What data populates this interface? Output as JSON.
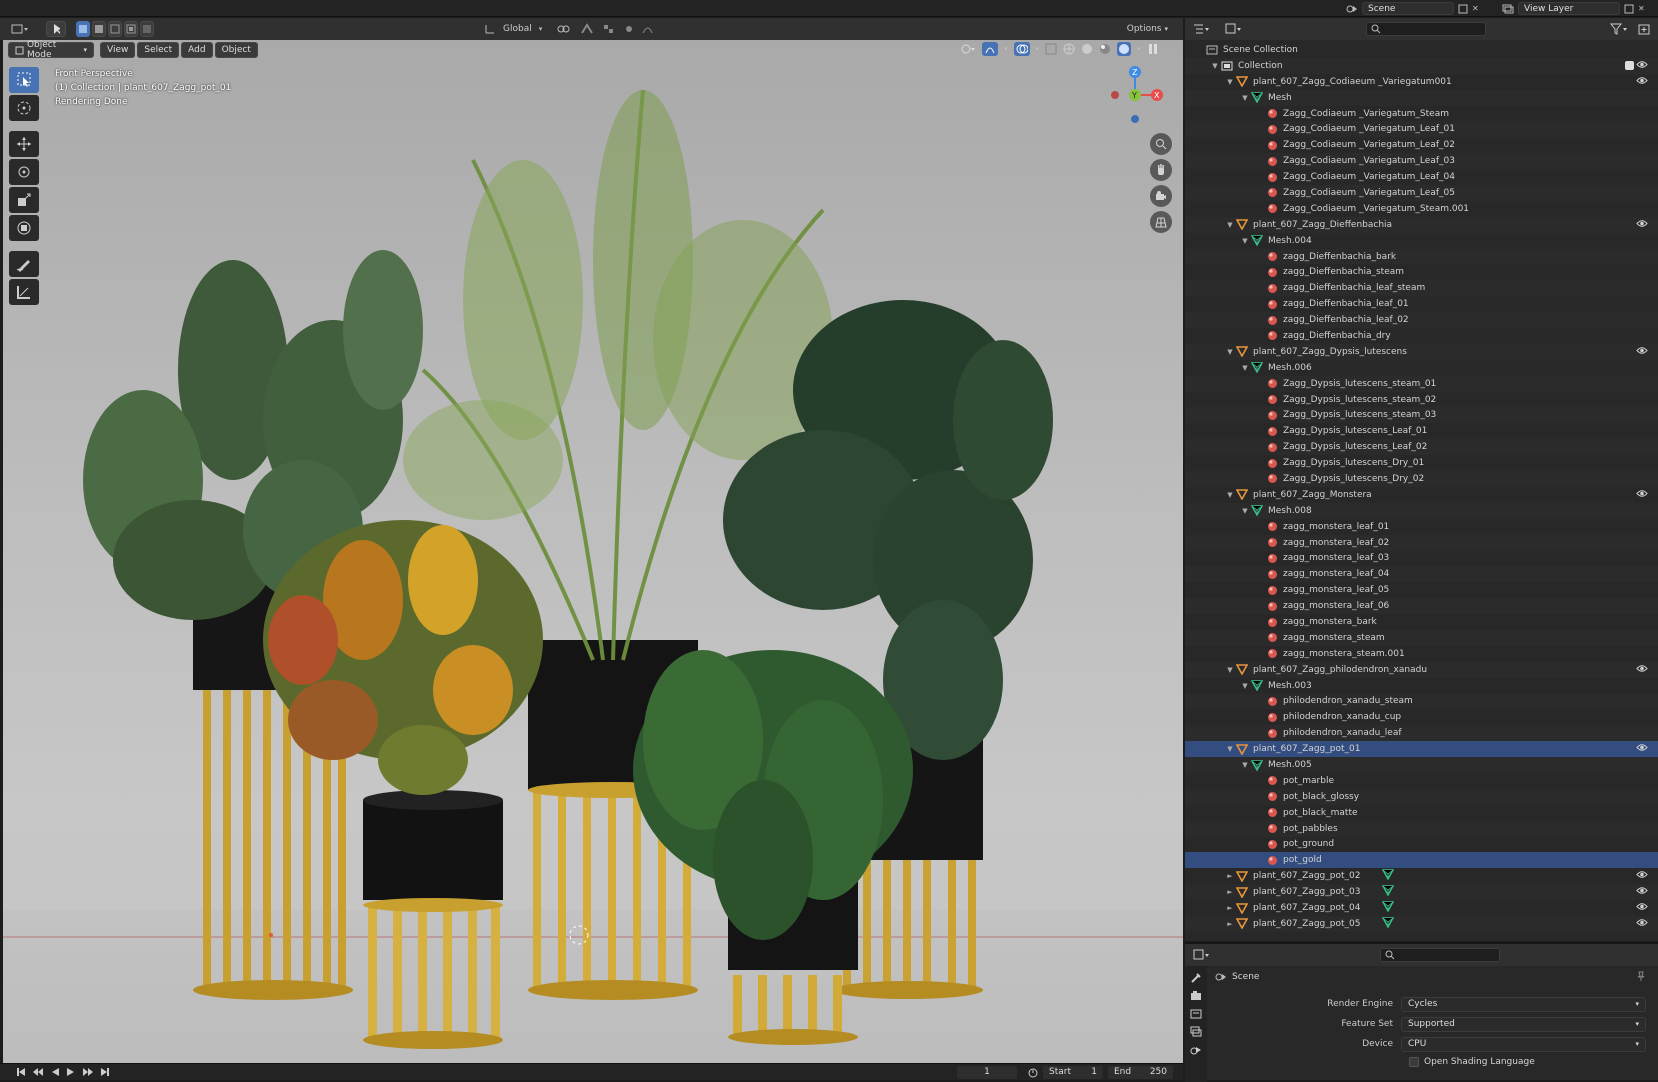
{
  "topbar": {
    "scene_label": "Scene",
    "view_layer_label": "View Layer"
  },
  "viewport_header": {
    "mode": "Object Mode",
    "menus": [
      "View",
      "Select",
      "Add",
      "Object"
    ],
    "transform_orientation": "Global",
    "options_label": "Options"
  },
  "viewport": {
    "info_line1": "Front Perspective",
    "info_line2": "(1) Collection | plant_607_Zagg_pot_01",
    "info_line3": "Rendering Done"
  },
  "outliner": {
    "rows": [
      {
        "depth": 0,
        "type": "scene",
        "label": "Scene Collection",
        "tri": "",
        "eye": false
      },
      {
        "depth": 1,
        "type": "collection",
        "label": "Collection",
        "tri": "▼",
        "eye": true,
        "check": true
      },
      {
        "depth": 2,
        "type": "object",
        "label": "plant_607_Zagg_Codiaeum _Variegatum001",
        "tri": "▼",
        "eye": true
      },
      {
        "depth": 3,
        "type": "mesh",
        "label": "Mesh",
        "tri": "▼",
        "eye": false
      },
      {
        "depth": 4,
        "type": "material",
        "label": "Zagg_Codiaeum _Variegatum_Steam",
        "tri": "",
        "eye": false
      },
      {
        "depth": 4,
        "type": "material",
        "label": "Zagg_Codiaeum _Variegatum_Leaf_01",
        "tri": "",
        "eye": false
      },
      {
        "depth": 4,
        "type": "material",
        "label": "Zagg_Codiaeum _Variegatum_Leaf_02",
        "tri": "",
        "eye": false
      },
      {
        "depth": 4,
        "type": "material",
        "label": "Zagg_Codiaeum _Variegatum_Leaf_03",
        "tri": "",
        "eye": false
      },
      {
        "depth": 4,
        "type": "material",
        "label": "Zagg_Codiaeum _Variegatum_Leaf_04",
        "tri": "",
        "eye": false
      },
      {
        "depth": 4,
        "type": "material",
        "label": "Zagg_Codiaeum _Variegatum_Leaf_05",
        "tri": "",
        "eye": false
      },
      {
        "depth": 4,
        "type": "material",
        "label": "Zagg_Codiaeum _Variegatum_Steam.001",
        "tri": "",
        "eye": false
      },
      {
        "depth": 2,
        "type": "object",
        "label": "plant_607_Zagg_Dieffenbachia",
        "tri": "▼",
        "eye": true
      },
      {
        "depth": 3,
        "type": "mesh",
        "label": "Mesh.004",
        "tri": "▼",
        "eye": false
      },
      {
        "depth": 4,
        "type": "material",
        "label": "zagg_Dieffenbachia_bark",
        "tri": "",
        "eye": false
      },
      {
        "depth": 4,
        "type": "material",
        "label": "zagg_Dieffenbachia_steam",
        "tri": "",
        "eye": false
      },
      {
        "depth": 4,
        "type": "material",
        "label": "zagg_Dieffenbachia_leaf_steam",
        "tri": "",
        "eye": false
      },
      {
        "depth": 4,
        "type": "material",
        "label": "zagg_Dieffenbachia_leaf_01",
        "tri": "",
        "eye": false
      },
      {
        "depth": 4,
        "type": "material",
        "label": "zagg_Dieffenbachia_leaf_02",
        "tri": "",
        "eye": false
      },
      {
        "depth": 4,
        "type": "material",
        "label": "zagg_Dieffenbachia_dry",
        "tri": "",
        "eye": false
      },
      {
        "depth": 2,
        "type": "object",
        "label": "plant_607_Zagg_Dypsis_lutescens",
        "tri": "▼",
        "eye": true
      },
      {
        "depth": 3,
        "type": "mesh",
        "label": "Mesh.006",
        "tri": "▼",
        "eye": false
      },
      {
        "depth": 4,
        "type": "material",
        "label": "Zagg_Dypsis_lutescens_steam_01",
        "tri": "",
        "eye": false
      },
      {
        "depth": 4,
        "type": "material",
        "label": "Zagg_Dypsis_lutescens_steam_02",
        "tri": "",
        "eye": false
      },
      {
        "depth": 4,
        "type": "material",
        "label": "Zagg_Dypsis_lutescens_steam_03",
        "tri": "",
        "eye": false
      },
      {
        "depth": 4,
        "type": "material",
        "label": "Zagg_Dypsis_lutescens_Leaf_01",
        "tri": "",
        "eye": false
      },
      {
        "depth": 4,
        "type": "material",
        "label": "Zagg_Dypsis_lutescens_Leaf_02",
        "tri": "",
        "eye": false
      },
      {
        "depth": 4,
        "type": "material",
        "label": "Zagg_Dypsis_lutescens_Dry_01",
        "tri": "",
        "eye": false
      },
      {
        "depth": 4,
        "type": "material",
        "label": "Zagg_Dypsis_lutescens_Dry_02",
        "tri": "",
        "eye": false
      },
      {
        "depth": 2,
        "type": "object",
        "label": "plant_607_Zagg_Monstera",
        "tri": "▼",
        "eye": true
      },
      {
        "depth": 3,
        "type": "mesh",
        "label": "Mesh.008",
        "tri": "▼",
        "eye": false
      },
      {
        "depth": 4,
        "type": "material",
        "label": "zagg_monstera_leaf_01",
        "tri": "",
        "eye": false
      },
      {
        "depth": 4,
        "type": "material",
        "label": "zagg_monstera_leaf_02",
        "tri": "",
        "eye": false
      },
      {
        "depth": 4,
        "type": "material",
        "label": "zagg_monstera_leaf_03",
        "tri": "",
        "eye": false
      },
      {
        "depth": 4,
        "type": "material",
        "label": "zagg_monstera_leaf_04",
        "tri": "",
        "eye": false
      },
      {
        "depth": 4,
        "type": "material",
        "label": "zagg_monstera_leaf_05",
        "tri": "",
        "eye": false
      },
      {
        "depth": 4,
        "type": "material",
        "label": "zagg_monstera_leaf_06",
        "tri": "",
        "eye": false
      },
      {
        "depth": 4,
        "type": "material",
        "label": "zagg_monstera_bark",
        "tri": "",
        "eye": false
      },
      {
        "depth": 4,
        "type": "material",
        "label": "zagg_monstera_steam",
        "tri": "",
        "eye": false
      },
      {
        "depth": 4,
        "type": "material",
        "label": "zagg_monstera_steam.001",
        "tri": "",
        "eye": false
      },
      {
        "depth": 2,
        "type": "object",
        "label": "plant_607_Zagg_philodendron_xanadu",
        "tri": "▼",
        "eye": true
      },
      {
        "depth": 3,
        "type": "mesh",
        "label": "Mesh.003",
        "tri": "▼",
        "eye": false
      },
      {
        "depth": 4,
        "type": "material",
        "label": "philodendron_xanadu_steam",
        "tri": "",
        "eye": false
      },
      {
        "depth": 4,
        "type": "material",
        "label": "philodendron_xanadu_cup",
        "tri": "",
        "eye": false
      },
      {
        "depth": 4,
        "type": "material",
        "label": "philodendron_xanadu_leaf",
        "tri": "",
        "eye": false
      },
      {
        "depth": 2,
        "type": "object",
        "label": "plant_607_Zagg_pot_01",
        "tri": "▼",
        "eye": true,
        "active": true
      },
      {
        "depth": 3,
        "type": "mesh",
        "label": "Mesh.005",
        "tri": "▼",
        "eye": false
      },
      {
        "depth": 4,
        "type": "material",
        "label": "pot_marble",
        "tri": "",
        "eye": false
      },
      {
        "depth": 4,
        "type": "material",
        "label": "pot_black_glossy",
        "tri": "",
        "eye": false
      },
      {
        "depth": 4,
        "type": "material",
        "label": "pot_black_matte",
        "tri": "",
        "eye": false
      },
      {
        "depth": 4,
        "type": "material",
        "label": "pot_pabbles",
        "tri": "",
        "eye": false
      },
      {
        "depth": 4,
        "type": "material",
        "label": "pot_ground",
        "tri": "",
        "eye": false
      },
      {
        "depth": 4,
        "type": "material",
        "label": "pot_gold",
        "tri": "",
        "eye": false,
        "active": true
      },
      {
        "depth": 2,
        "type": "object",
        "label": "plant_607_Zagg_pot_02",
        "tri": "►",
        "eye": true,
        "mesh_badge": true
      },
      {
        "depth": 2,
        "type": "object",
        "label": "plant_607_Zagg_pot_03",
        "tri": "►",
        "eye": true,
        "mesh_badge": true
      },
      {
        "depth": 2,
        "type": "object",
        "label": "plant_607_Zagg_pot_04",
        "tri": "►",
        "eye": true,
        "mesh_badge": true
      },
      {
        "depth": 2,
        "type": "object",
        "label": "plant_607_Zagg_pot_05",
        "tri": "►",
        "eye": true,
        "mesh_badge": true
      }
    ]
  },
  "properties": {
    "context_label": "Scene",
    "render_engine_label": "Render Engine",
    "render_engine_value": "Cycles",
    "feature_set_label": "Feature Set",
    "feature_set_value": "Supported",
    "device_label": "Device",
    "device_value": "CPU",
    "osl_label": "Open Shading Language"
  },
  "timeline": {
    "current_frame": "1",
    "start_label": "Start",
    "start_value": "1",
    "end_label": "End",
    "end_value": "250"
  },
  "colors": {
    "accent": "#4772b3",
    "object_icon": "#e8953c",
    "mesh_icon": "#39c28a",
    "material_icon": "#d9574f",
    "axis_x": "#e94e4e",
    "axis_y": "#87c33b",
    "axis_z": "#3d8ae8"
  }
}
